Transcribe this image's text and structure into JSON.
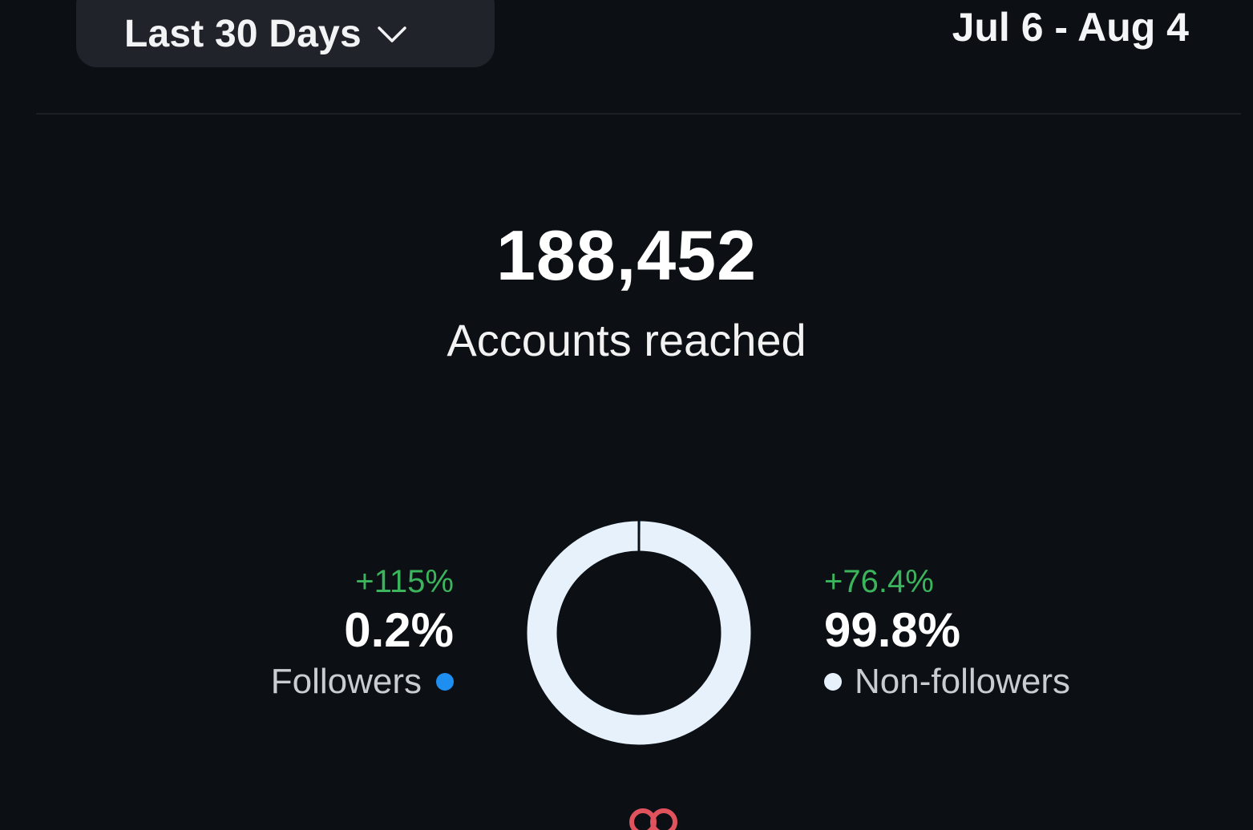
{
  "header": {
    "range_selector": {
      "label": "Last 30 Days",
      "icon": "chevron-down-icon"
    },
    "date_range": "Jul 6 - Aug 4"
  },
  "summary": {
    "value": "188,452",
    "label": "Accounts reached"
  },
  "breakdown": {
    "followers": {
      "delta": "+115%",
      "percent": "0.2%",
      "label": "Followers",
      "share": 0.002,
      "color": "#1f8ef1"
    },
    "non_followers": {
      "delta": "+76.4%",
      "percent": "99.8%",
      "label": "Non-followers",
      "share": 0.998,
      "color": "#e6f1fb"
    }
  },
  "colors": {
    "background": "#0c0f14",
    "button_bg": "#202329",
    "positive": "#3bb55c",
    "partial_icon": "#e0535d"
  }
}
